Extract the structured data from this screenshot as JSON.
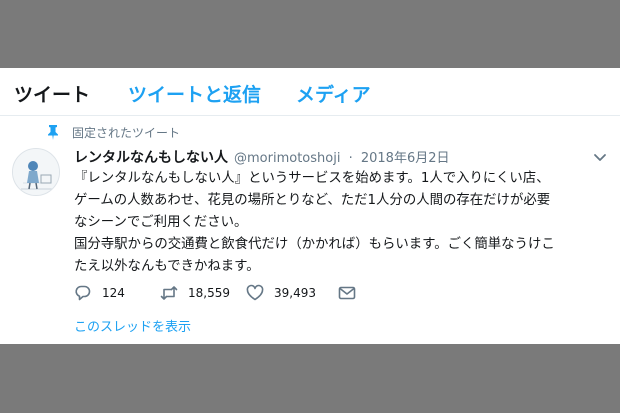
{
  "tabs": [
    {
      "label": "ツイート"
    },
    {
      "label": "ツイートと返信"
    },
    {
      "label": "メディア"
    }
  ],
  "tweet": {
    "pinned_label": "固定されたツイート",
    "author_name": "レンタルなんもしない人",
    "handle": "@morimotoshoji",
    "separator": "·",
    "date": "2018年6月2日",
    "text_lines": [
      "『レンタルなんもしない人』というサービスを始めます。1人で入りにくい店、",
      "ゲームの人数あわせ、花見の場所とりなど、ただ1人分の人間の存在だけが必要",
      "なシーンでご利用ください。",
      "国分寺駅からの交通費と飲食代だけ（かかれば）もらいます。ごく簡単なうけこ",
      "たえ以外なんもできかねます。"
    ],
    "replies": "124",
    "retweets": "18,559",
    "likes": "39,493",
    "thread_link": "このスレッドを表示"
  },
  "colors": {
    "accent": "#1da1f2",
    "text": "#14171a",
    "muted": "#657786",
    "backdrop": "#7a7a7a"
  },
  "icons": [
    "pin-icon",
    "avatar",
    "chevron-down-icon",
    "reply-icon",
    "retweet-icon",
    "like-icon",
    "share-icon"
  ]
}
